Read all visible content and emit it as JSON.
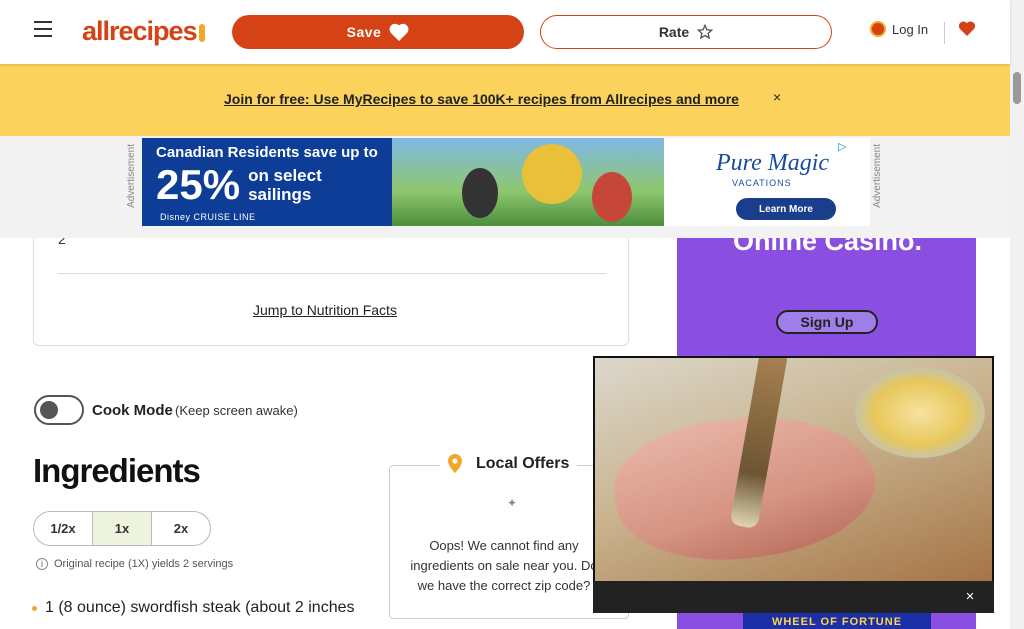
{
  "header": {
    "logo_text": "allrecipes",
    "save_label": "Save",
    "rate_label": "Rate",
    "login_label": "Log In",
    "icons": [
      "menu-icon",
      "heart-icon",
      "star-icon",
      "user-icon",
      "heart-icon"
    ]
  },
  "promo": {
    "link_text": "Join for free: Use MyRecipes to save 100K+ recipes from Allrecipes and more"
  },
  "ad_banner": {
    "label": "Advertisement",
    "headline": "Canadian Residents save up to",
    "percent": "25%",
    "sub_line1": "on select",
    "sub_line2": "sailings",
    "brand": "Disney CRUISE LINE",
    "right_brand": "Pure Magic",
    "right_sub": "VACATIONS",
    "cta": "Learn More"
  },
  "recipe_card": {
    "servings_value": "2",
    "jump_link": "Jump to Nutrition Facts"
  },
  "cook_mode": {
    "label": "Cook Mode",
    "hint": "(Keep screen awake)"
  },
  "ingredients": {
    "title": "Ingredients",
    "scale_options": [
      "1/2x",
      "1x",
      "2x"
    ],
    "scale_selected": "1x",
    "original_note": "Original recipe (1X) yields 2 servings",
    "items": [
      "1 (8 ounce) swordfish steak (about 2 inches"
    ]
  },
  "local_offers": {
    "title": "Local Offers",
    "message": "Oops! We cannot find any ingredients on sale near you. Do we have the correct zip code?"
  },
  "side_ad": {
    "title": "Online Casino.",
    "cta": "Sign Up",
    "bottom_brand": "WHEEL OF FORTUNE"
  },
  "colors": {
    "brand": "#d54215",
    "promo_bg": "#fbd25c",
    "side_ad_bg": "#8a4fe0"
  }
}
